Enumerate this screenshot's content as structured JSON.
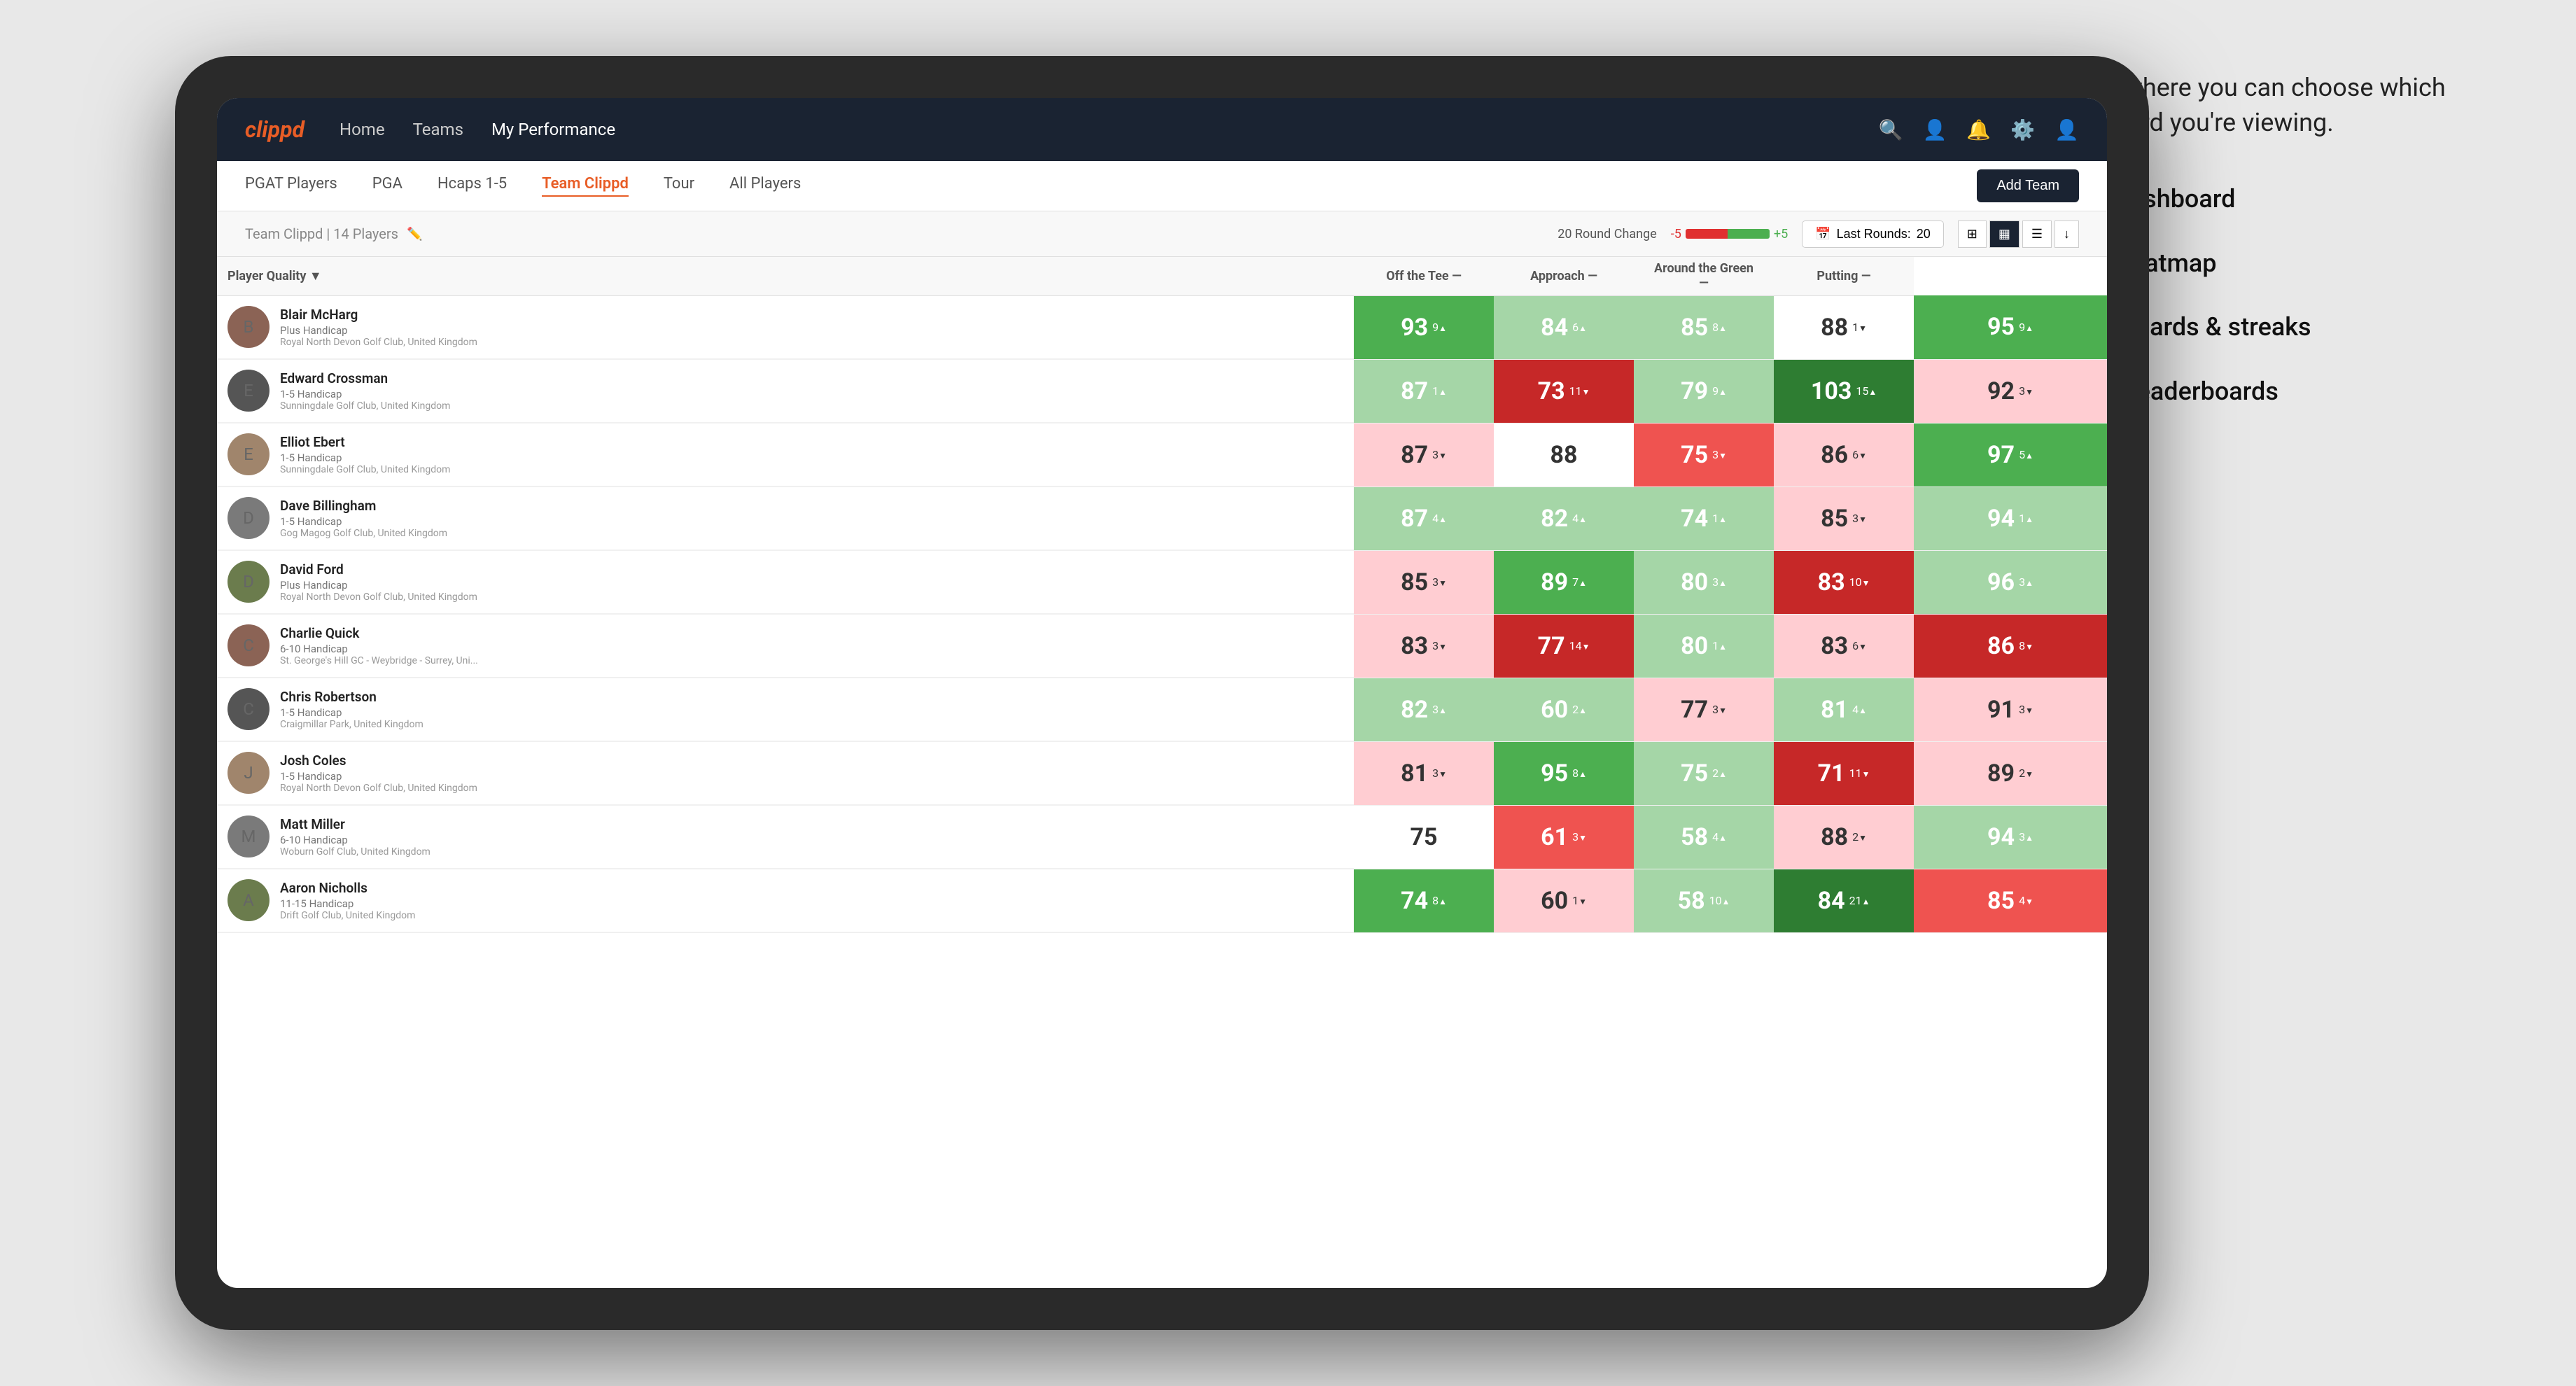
{
  "annotation": {
    "intro": "This is where you can choose which dashboard you're viewing.",
    "items": [
      "Team Dashboard",
      "Team Heatmap",
      "Leaderboards & streaks",
      "Course leaderboards"
    ]
  },
  "nav": {
    "logo": "clippd",
    "links": [
      "Home",
      "Teams",
      "My Performance"
    ],
    "active": "My Performance"
  },
  "sub_nav": {
    "links": [
      "PGAT Players",
      "PGA",
      "Hcaps 1-5",
      "Team Clippd",
      "Tour",
      "All Players"
    ],
    "active": "Team Clippd",
    "add_team": "Add Team"
  },
  "team_header": {
    "name": "Team Clippd",
    "separator": " | ",
    "count": "14 Players",
    "round_change_label": "20 Round Change",
    "change_neg": "-5",
    "change_pos": "+5",
    "last_rounds_label": "Last Rounds:",
    "last_rounds_value": "20"
  },
  "col_headers": {
    "player": "Player Quality ▼",
    "off_tee": "Off the Tee —",
    "approach": "Approach —",
    "around_green": "Around the Green —",
    "putting": "Putting —"
  },
  "players": [
    {
      "name": "Blair McHarg",
      "handicap": "Plus Handicap",
      "club": "Royal North Devon Golf Club, United Kingdom",
      "avatar_color": "av-brown",
      "scores": [
        {
          "value": 93,
          "change": "9",
          "dir": "up",
          "color": "green-mid"
        },
        {
          "value": 84,
          "change": "6",
          "dir": "up",
          "color": "green-light"
        },
        {
          "value": 85,
          "change": "8",
          "dir": "up",
          "color": "green-light"
        },
        {
          "value": 88,
          "change": "1",
          "dir": "down",
          "color": "white"
        },
        {
          "value": 95,
          "change": "9",
          "dir": "up",
          "color": "green-mid"
        }
      ]
    },
    {
      "name": "Edward Crossman",
      "handicap": "1-5 Handicap",
      "club": "Sunningdale Golf Club, United Kingdom",
      "avatar_color": "av-dark",
      "scores": [
        {
          "value": 87,
          "change": "1",
          "dir": "up",
          "color": "green-light"
        },
        {
          "value": 73,
          "change": "11",
          "dir": "down",
          "color": "red-dark"
        },
        {
          "value": 79,
          "change": "9",
          "dir": "up",
          "color": "green-light"
        },
        {
          "value": 103,
          "change": "15",
          "dir": "up",
          "color": "green-dark"
        },
        {
          "value": 92,
          "change": "3",
          "dir": "down",
          "color": "red-light"
        }
      ]
    },
    {
      "name": "Elliot Ebert",
      "handicap": "1-5 Handicap",
      "club": "Sunningdale Golf Club, United Kingdom",
      "avatar_color": "av-tan",
      "scores": [
        {
          "value": 87,
          "change": "3",
          "dir": "down",
          "color": "red-light"
        },
        {
          "value": 88,
          "change": "",
          "dir": "",
          "color": "white"
        },
        {
          "value": 75,
          "change": "3",
          "dir": "down",
          "color": "red-mid"
        },
        {
          "value": 86,
          "change": "6",
          "dir": "down",
          "color": "red-light"
        },
        {
          "value": 97,
          "change": "5",
          "dir": "up",
          "color": "green-mid"
        }
      ]
    },
    {
      "name": "Dave Billingham",
      "handicap": "1-5 Handicap",
      "club": "Gog Magog Golf Club, United Kingdom",
      "avatar_color": "av-gray",
      "scores": [
        {
          "value": 87,
          "change": "4",
          "dir": "up",
          "color": "green-light"
        },
        {
          "value": 82,
          "change": "4",
          "dir": "up",
          "color": "green-light"
        },
        {
          "value": 74,
          "change": "1",
          "dir": "up",
          "color": "green-light"
        },
        {
          "value": 85,
          "change": "3",
          "dir": "down",
          "color": "red-light"
        },
        {
          "value": 94,
          "change": "1",
          "dir": "up",
          "color": "green-light"
        }
      ]
    },
    {
      "name": "David Ford",
      "handicap": "Plus Handicap",
      "club": "Royal North Devon Golf Club, United Kingdom",
      "avatar_color": "av-olive",
      "scores": [
        {
          "value": 85,
          "change": "3",
          "dir": "down",
          "color": "red-light"
        },
        {
          "value": 89,
          "change": "7",
          "dir": "up",
          "color": "green-mid"
        },
        {
          "value": 80,
          "change": "3",
          "dir": "up",
          "color": "green-light"
        },
        {
          "value": 83,
          "change": "10",
          "dir": "down",
          "color": "red-dark"
        },
        {
          "value": 96,
          "change": "3",
          "dir": "up",
          "color": "green-light"
        }
      ]
    },
    {
      "name": "Charlie Quick",
      "handicap": "6-10 Handicap",
      "club": "St. George's Hill GC - Weybridge - Surrey, Uni...",
      "avatar_color": "av-brown",
      "scores": [
        {
          "value": 83,
          "change": "3",
          "dir": "down",
          "color": "red-light"
        },
        {
          "value": 77,
          "change": "14",
          "dir": "down",
          "color": "red-dark"
        },
        {
          "value": 80,
          "change": "1",
          "dir": "up",
          "color": "green-light"
        },
        {
          "value": 83,
          "change": "6",
          "dir": "down",
          "color": "red-light"
        },
        {
          "value": 86,
          "change": "8",
          "dir": "down",
          "color": "red-dark"
        }
      ]
    },
    {
      "name": "Chris Robertson",
      "handicap": "1-5 Handicap",
      "club": "Craigmillar Park, United Kingdom",
      "avatar_color": "av-dark",
      "scores": [
        {
          "value": 82,
          "change": "3",
          "dir": "up",
          "color": "green-light"
        },
        {
          "value": 60,
          "change": "2",
          "dir": "up",
          "color": "green-light"
        },
        {
          "value": 77,
          "change": "3",
          "dir": "down",
          "color": "red-light"
        },
        {
          "value": 81,
          "change": "4",
          "dir": "up",
          "color": "green-light"
        },
        {
          "value": 91,
          "change": "3",
          "dir": "down",
          "color": "red-light"
        }
      ]
    },
    {
      "name": "Josh Coles",
      "handicap": "1-5 Handicap",
      "club": "Royal North Devon Golf Club, United Kingdom",
      "avatar_color": "av-tan",
      "scores": [
        {
          "value": 81,
          "change": "3",
          "dir": "down",
          "color": "red-light"
        },
        {
          "value": 95,
          "change": "8",
          "dir": "up",
          "color": "green-mid"
        },
        {
          "value": 75,
          "change": "2",
          "dir": "up",
          "color": "green-light"
        },
        {
          "value": 71,
          "change": "11",
          "dir": "down",
          "color": "red-dark"
        },
        {
          "value": 89,
          "change": "2",
          "dir": "down",
          "color": "red-light"
        }
      ]
    },
    {
      "name": "Matt Miller",
      "handicap": "6-10 Handicap",
      "club": "Woburn Golf Club, United Kingdom",
      "avatar_color": "av-gray",
      "scores": [
        {
          "value": 75,
          "change": "",
          "dir": "",
          "color": "white"
        },
        {
          "value": 61,
          "change": "3",
          "dir": "down",
          "color": "red-mid"
        },
        {
          "value": 58,
          "change": "4",
          "dir": "up",
          "color": "green-light"
        },
        {
          "value": 88,
          "change": "2",
          "dir": "down",
          "color": "red-light"
        },
        {
          "value": 94,
          "change": "3",
          "dir": "up",
          "color": "green-light"
        }
      ]
    },
    {
      "name": "Aaron Nicholls",
      "handicap": "11-15 Handicap",
      "club": "Drift Golf Club, United Kingdom",
      "avatar_color": "av-olive",
      "scores": [
        {
          "value": 74,
          "change": "8",
          "dir": "up",
          "color": "green-mid"
        },
        {
          "value": 60,
          "change": "1",
          "dir": "down",
          "color": "red-light"
        },
        {
          "value": 58,
          "change": "10",
          "dir": "up",
          "color": "green-light"
        },
        {
          "value": 84,
          "change": "21",
          "dir": "up",
          "color": "green-dark"
        },
        {
          "value": 85,
          "change": "4",
          "dir": "down",
          "color": "red-mid"
        }
      ]
    }
  ]
}
